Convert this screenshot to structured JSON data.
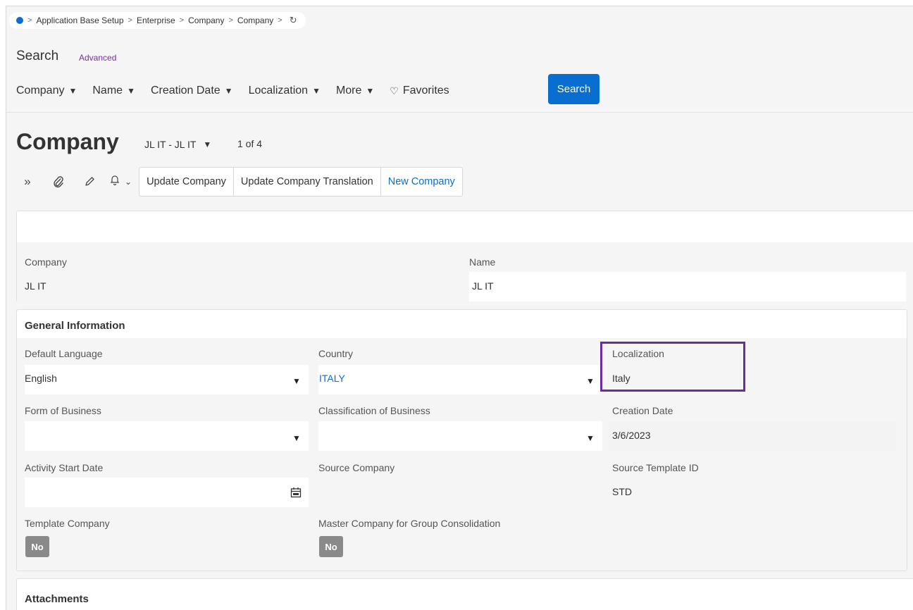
{
  "breadcrumb": {
    "items": [
      "Application Base Setup",
      "Enterprise",
      "Company",
      "Company"
    ],
    "separator": ">",
    "home_icon": "home-dot-icon",
    "refresh_icon": "refresh-icon"
  },
  "search": {
    "title": "Search",
    "advanced_label": "Advanced",
    "filters": [
      {
        "label": "Company"
      },
      {
        "label": "Name"
      },
      {
        "label": "Creation Date"
      },
      {
        "label": "Localization"
      },
      {
        "label": "More"
      }
    ],
    "favorites_label": "Favorites",
    "button_label": "Search"
  },
  "record": {
    "title": "Company",
    "selector": "JL IT - JL IT",
    "count": "1 of 4"
  },
  "toolbar": {
    "commands": [
      "Update Company",
      "Update Company Translation",
      "New Company"
    ]
  },
  "header_fields": {
    "company_label": "Company",
    "company_value": "JL IT",
    "name_label": "Name",
    "name_value": "JL IT"
  },
  "general": {
    "title": "General Information",
    "default_language_label": "Default Language",
    "default_language_value": "English",
    "country_label": "Country",
    "country_value": "ITALY",
    "localization_label": "Localization",
    "localization_value": "Italy",
    "form_of_business_label": "Form of Business",
    "form_of_business_value": "",
    "classification_label": "Classification of Business",
    "classification_value": "",
    "creation_date_label": "Creation Date",
    "creation_date_value": "3/6/2023",
    "activity_start_label": "Activity Start Date",
    "activity_start_value": "",
    "source_company_label": "Source Company",
    "source_template_label": "Source Template ID",
    "source_template_value": "STD",
    "template_company_label": "Template Company",
    "template_company_value": "No",
    "master_company_label": "Master Company for Group Consolidation",
    "master_company_value": "No"
  },
  "attachments": {
    "title": "Attachments"
  },
  "colors": {
    "accent": "#0a6ed1",
    "highlight": "#6a2ca0",
    "advanced_link": "#7a2ea0"
  }
}
